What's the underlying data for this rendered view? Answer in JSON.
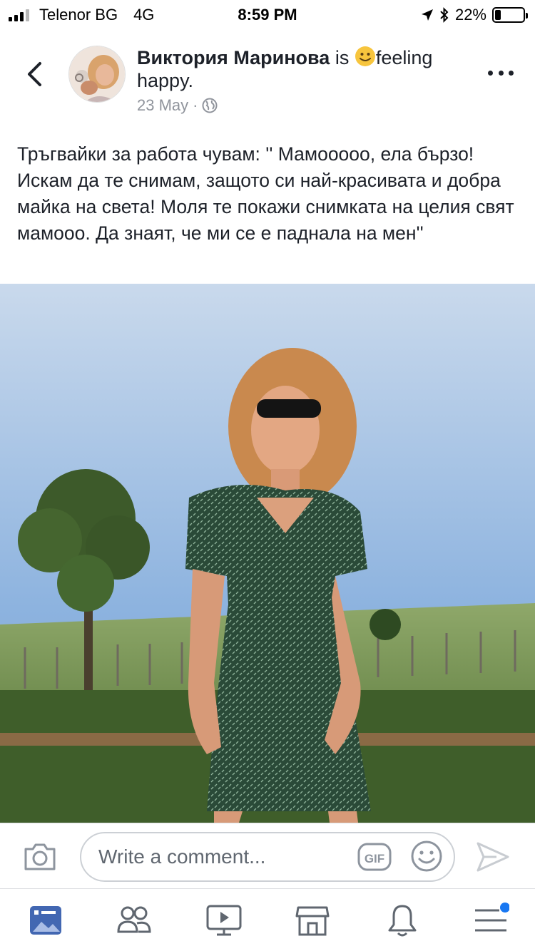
{
  "status_bar": {
    "carrier": "Telenor BG",
    "network": "4G",
    "time": "8:59 PM",
    "battery_percent": "22%",
    "battery_level": 0.22
  },
  "header": {
    "author": "Виктория Маринова",
    "is_text": "is",
    "feeling_text": "feeling happy.",
    "date": "23 May",
    "separator": "·"
  },
  "post": {
    "text": "Тръгвайки за работа чувам: '' Мамооооо,  ела бързо!  Искам да те снимам,  защото си най-красивата и добра майка на света! Моля те покажи снимката на целия свят мамооо. Да знаят,  че ми се е паднала на мен''"
  },
  "comment_bar": {
    "placeholder": "Write a comment..."
  },
  "icons": {
    "back": "chevron-left-icon",
    "more": "more-dots-icon",
    "globe": "globe-icon",
    "camera": "camera-icon",
    "gif": "gif-icon",
    "smiley": "smiley-icon",
    "send": "send-icon",
    "tabs": [
      "news-feed-icon",
      "friends-icon",
      "watch-icon",
      "marketplace-icon",
      "notifications-icon",
      "menu-icon"
    ]
  },
  "colors": {
    "accent": "#4267b2",
    "text": "#1d2129",
    "muted": "#90949c",
    "notification_dot": "#1877f2",
    "emoji": "#f7c53d"
  }
}
